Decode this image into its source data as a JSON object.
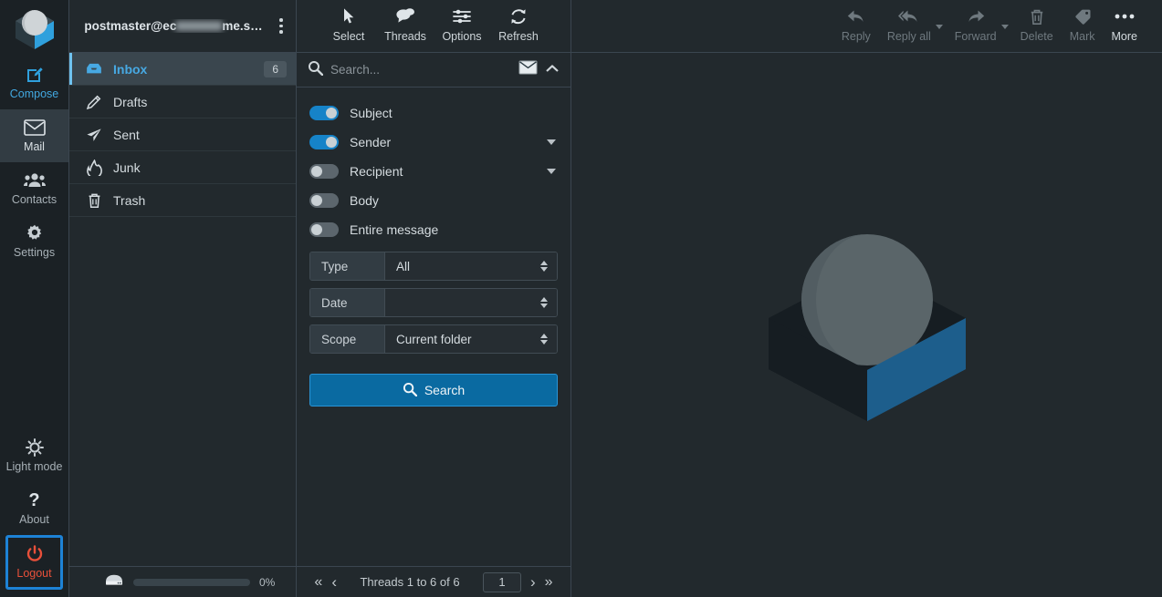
{
  "app": {
    "name": "Roundcube Webmail",
    "accent": "#1683c8",
    "background": "#22292d",
    "danger": "#e8503a",
    "focus_outline": "#1d82d6"
  },
  "taskbar": {
    "logo_icon": "roundcube-logo-icon",
    "items": [
      {
        "key": "compose",
        "label": "Compose",
        "icon": "compose-pencil-icon",
        "state": "accent"
      },
      {
        "key": "mail",
        "label": "Mail",
        "icon": "envelope-icon",
        "state": "selected"
      },
      {
        "key": "contacts",
        "label": "Contacts",
        "icon": "contacts-people-icon",
        "state": "normal"
      },
      {
        "key": "settings",
        "label": "Settings",
        "icon": "gear-icon",
        "state": "normal"
      }
    ],
    "bottom_items": [
      {
        "key": "lightmode",
        "label": "Light mode",
        "icon": "sun-icon",
        "state": "normal"
      },
      {
        "key": "about",
        "label": "About",
        "icon": "question-mark-icon",
        "state": "normal"
      },
      {
        "key": "logout",
        "label": "Logout",
        "icon": "power-icon",
        "state": "danger-focused"
      }
    ]
  },
  "folders": {
    "account": {
      "prefix": "postmaster@ec",
      "redacted": true,
      "suffix": "me.s…",
      "options_icon": "kebab-menu-icon"
    },
    "items": [
      {
        "key": "inbox",
        "label": "Inbox",
        "icon": "inbox-icon",
        "badge": "6",
        "selected": true
      },
      {
        "key": "drafts",
        "label": "Drafts",
        "icon": "pencil-icon",
        "badge": "",
        "selected": false
      },
      {
        "key": "sent",
        "label": "Sent",
        "icon": "paper-plane-icon",
        "badge": "",
        "selected": false
      },
      {
        "key": "junk",
        "label": "Junk",
        "icon": "fire-icon",
        "badge": "",
        "selected": false
      },
      {
        "key": "trash",
        "label": "Trash",
        "icon": "trash-icon",
        "badge": "",
        "selected": false
      }
    ],
    "footer": {
      "quota_icon": "disk-quota-icon",
      "quota_percent": "0%",
      "quota_fill": 0
    }
  },
  "list_toolbar": {
    "buttons": [
      {
        "key": "select",
        "label": "Select",
        "icon": "cursor-arrow-icon"
      },
      {
        "key": "threads",
        "label": "Threads",
        "icon": "threads-bubbles-icon"
      },
      {
        "key": "options",
        "label": "Options",
        "icon": "sliders-icon"
      },
      {
        "key": "refresh",
        "label": "Refresh",
        "icon": "refresh-icon"
      }
    ]
  },
  "search": {
    "icon": "search-icon",
    "placeholder": "Search...",
    "value": "",
    "scope_icon": "envelope-icon",
    "collapse_icon": "chevron-up-icon",
    "toggles": [
      {
        "key": "subject",
        "label": "Subject",
        "on": true,
        "has_caret": false
      },
      {
        "key": "sender",
        "label": "Sender",
        "on": true,
        "has_caret": true
      },
      {
        "key": "recipient",
        "label": "Recipient",
        "on": false,
        "has_caret": true
      },
      {
        "key": "body",
        "label": "Body",
        "on": false,
        "has_caret": false
      },
      {
        "key": "entire_message",
        "label": "Entire message",
        "on": false,
        "has_caret": false
      }
    ],
    "selects": [
      {
        "key": "type",
        "label": "Type",
        "value": "All"
      },
      {
        "key": "date",
        "label": "Date",
        "value": ""
      },
      {
        "key": "scope",
        "label": "Scope",
        "value": "Current folder"
      }
    ],
    "submit_label": "Search",
    "submit_icon": "search-icon"
  },
  "list_footer": {
    "first_icon": "first-page-icon",
    "prev_icon": "prev-page-icon",
    "status": "Threads 1 to 6 of 6",
    "page_value": "1",
    "next_icon": "next-page-icon",
    "last_icon": "last-page-icon"
  },
  "message_toolbar": {
    "buttons": [
      {
        "key": "reply",
        "label": "Reply",
        "icon": "reply-icon",
        "enabled": false,
        "has_caret": false
      },
      {
        "key": "reply_all",
        "label": "Reply all",
        "icon": "reply-all-icon",
        "enabled": false,
        "has_caret": true
      },
      {
        "key": "forward",
        "label": "Forward",
        "icon": "forward-icon",
        "enabled": false,
        "has_caret": true
      },
      {
        "key": "delete",
        "label": "Delete",
        "icon": "trash-icon",
        "enabled": false,
        "has_caret": false
      },
      {
        "key": "mark",
        "label": "Mark",
        "icon": "tag-icon",
        "enabled": false,
        "has_caret": false
      },
      {
        "key": "more",
        "label": "More",
        "icon": "ellipsis-icon",
        "enabled": true,
        "has_caret": false
      }
    ]
  },
  "content": {
    "watermark_icon": "roundcube-watermark-icon"
  }
}
